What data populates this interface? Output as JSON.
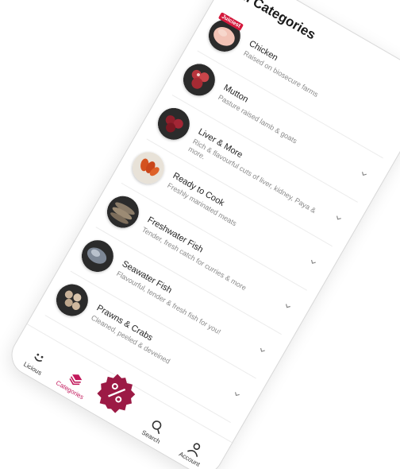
{
  "header": {
    "title": "All Categories"
  },
  "categories": [
    {
      "name": "Chicken",
      "desc": "Raised on biosecure farms",
      "badge": "Juiciest",
      "color": "#f2c3b6",
      "icon": "chicken-thumb"
    },
    {
      "name": "Mutton",
      "desc": "Pasture raised lamb & goats",
      "badge": "",
      "color": "#b8353d",
      "icon": "mutton-thumb"
    },
    {
      "name": "Liver & More",
      "desc": "Rich & flavourful cuts of liver, kidney, Paya & more.",
      "badge": "",
      "color": "#8f1f2b",
      "icon": "liver-thumb"
    },
    {
      "name": "Ready to Cook",
      "desc": "Freshly marinated meats",
      "badge": "",
      "color": "#d4521e",
      "icon": "ready-to-cook-thumb"
    },
    {
      "name": "Freshwater Fish",
      "desc": "Tender, fresh catch for curries & more",
      "badge": "",
      "color": "#8a7b68",
      "icon": "freshwater-fish-thumb"
    },
    {
      "name": "Seawater Fish",
      "desc": "Flavourful, tender & fresh fish for you!",
      "badge": "",
      "color": "#7d8795",
      "icon": "seawater-fish-thumb"
    },
    {
      "name": "Prawns & Crabs",
      "desc": "Cleaned, peeled & deveined",
      "badge": "",
      "color": "#c9b39a",
      "icon": "prawns-thumb"
    }
  ],
  "nav": {
    "items": [
      {
        "label": "Licious",
        "icon": "smiley-icon"
      },
      {
        "label": "Categories",
        "icon": "layers-icon"
      },
      {
        "label": "Search",
        "icon": "search-icon"
      },
      {
        "label": "Account",
        "icon": "user-icon"
      }
    ],
    "active_color": "#c2185b",
    "offer_icon": "percent-badge-icon"
  }
}
